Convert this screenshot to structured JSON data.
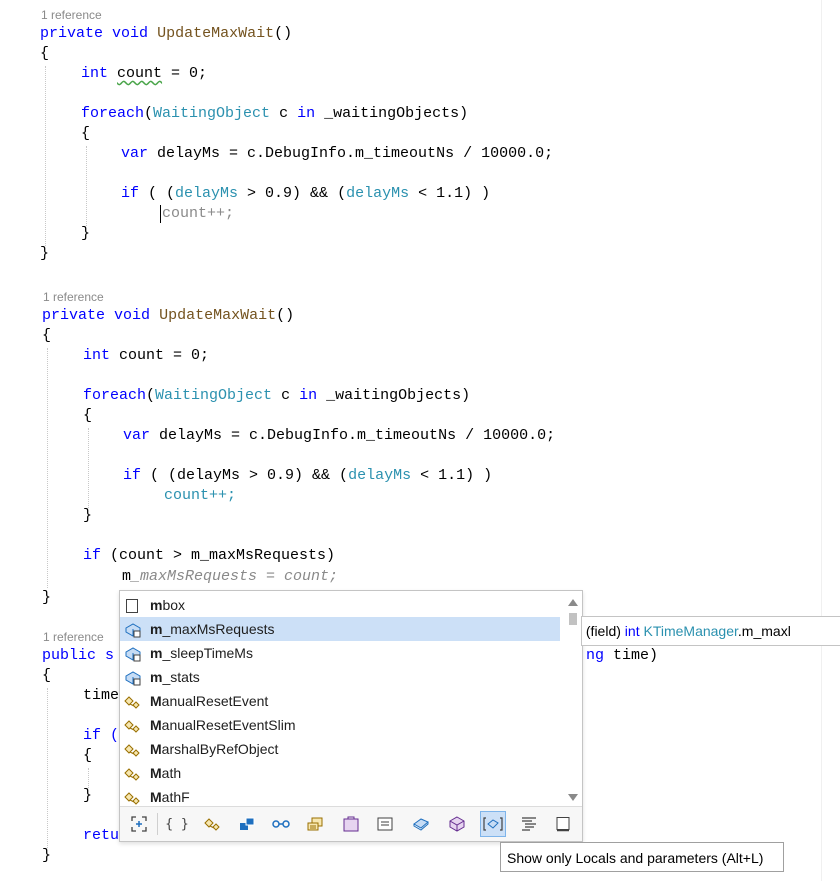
{
  "block1": {
    "references": "1 reference",
    "sig": {
      "access": "private",
      "ret": "void",
      "name": "UpdateMaxWait",
      "parens": "()"
    },
    "open_brace": "{",
    "decl": {
      "type": "int",
      "name": "count",
      "rest": " = 0;"
    },
    "foreach": {
      "kw": "foreach",
      "open": "(",
      "type": "WaitingObject",
      "var": " c ",
      "in": "in",
      "rest": " _waitingObjects)"
    },
    "inner_open": "{",
    "var_line": {
      "kw": "var",
      "rest": " delayMs = c.DebugInfo.m_timeoutNs / 10000.0;"
    },
    "if_line": {
      "kw": "if",
      "a": " ( (",
      "v1": "delayMs",
      "b": " > 0.9) && (",
      "v2": "delayMs",
      "c": " < 1.1) )"
    },
    "count_line": "count++;",
    "inner_close": "}",
    "close_brace": "}"
  },
  "block2": {
    "references": "1 reference",
    "sig": {
      "access": "private",
      "ret": "void",
      "name": "UpdateMaxWait",
      "parens": "()"
    },
    "open_brace": "{",
    "decl": {
      "type": "int",
      "name": " count = 0;"
    },
    "foreach": {
      "kw": "foreach",
      "open": "(",
      "type": "WaitingObject",
      "var": " c ",
      "in": "in",
      "rest": " _waitingObjects)"
    },
    "inner_open": "{",
    "var_line": {
      "kw": "var",
      "rest": " delayMs = c.DebugInfo.m_timeoutNs / 10000.0;"
    },
    "if_line": {
      "kw": "if",
      "a": " ( (delayMs > 0.9) && (",
      "v2": "delayMs",
      "c": " < 1.1) )"
    },
    "count_line": "count++;",
    "inner_close": "}",
    "if2": {
      "kw": "if",
      "rest": " (count > m_maxMsRequests)"
    },
    "assign": {
      "prefix": "m",
      "suggest": "_maxMsRequests = count;"
    },
    "close_brace": "}"
  },
  "block3": {
    "references": "1 reference",
    "sig_start": "public s",
    "sig_end": "ng time)",
    "open_brace": "{",
    "time_line": "time",
    "if_line": "if (",
    "inner_open": "{",
    "inner_close": "}",
    "return_line": "retu",
    "close_brace": "}"
  },
  "completion": {
    "items": [
      {
        "bold": "m",
        "rest": "box",
        "icon": "namespace-icon",
        "selected": false
      },
      {
        "bold": "m",
        "rest": "_maxMsRequests",
        "icon": "field-icon",
        "selected": true
      },
      {
        "bold": "m",
        "rest": "_sleepTimeMs",
        "icon": "field-icon",
        "selected": false
      },
      {
        "bold": "m",
        "rest": "_stats",
        "icon": "field-icon",
        "selected": false
      },
      {
        "bold": "M",
        "rest": "anualResetEvent",
        "icon": "class-icon",
        "selected": false
      },
      {
        "bold": "M",
        "rest": "anualResetEventSlim",
        "icon": "class-icon",
        "selected": false
      },
      {
        "bold": "M",
        "rest": "arshalByRefObject",
        "icon": "class-icon",
        "selected": false
      },
      {
        "bold": "M",
        "rest": "ath",
        "icon": "class-icon",
        "selected": false
      },
      {
        "bold": "M",
        "rest": "athF",
        "icon": "class-icon",
        "selected": false
      }
    ],
    "filters": [
      {
        "name": "expand-filter-icon",
        "glyph": ""
      },
      {
        "name": "namespace-filter-icon",
        "glyph": "{ }"
      },
      {
        "name": "class-filter-icon",
        "glyph": ""
      },
      {
        "name": "struct-filter-icon",
        "glyph": ""
      },
      {
        "name": "interface-filter-icon",
        "glyph": ""
      },
      {
        "name": "enum-filter-icon",
        "glyph": ""
      },
      {
        "name": "delegate-filter-icon",
        "glyph": ""
      },
      {
        "name": "module-filter-icon",
        "glyph": ""
      },
      {
        "name": "field-filter-icon",
        "glyph": ""
      },
      {
        "name": "method-filter-icon",
        "glyph": ""
      },
      {
        "name": "locals-filter-icon",
        "glyph": ""
      },
      {
        "name": "snippet-filter-icon",
        "glyph": ""
      },
      {
        "name": "keyword-filter-icon",
        "glyph": ""
      }
    ]
  },
  "quickinfo": {
    "kind": "(field) ",
    "type": "int",
    "cls": "KTimeManager",
    "member": ".m_maxl"
  },
  "tooltip": "Show only Locals and parameters (Alt+L)"
}
